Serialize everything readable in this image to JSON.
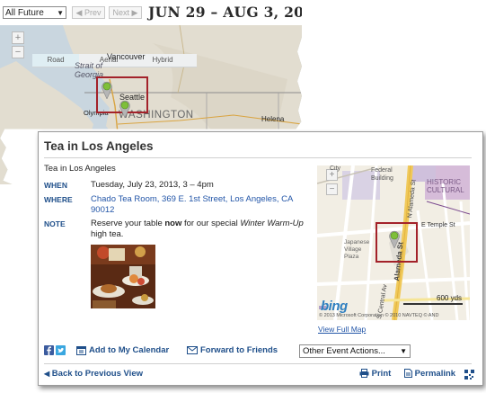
{
  "calendar": {
    "view_filter": "All Future",
    "prev_label": "◀ Prev",
    "next_label": "Next ▶",
    "date_range": "JUN 29 – AUG 3, 2013"
  },
  "region_map": {
    "tabs": [
      "Road",
      "Aerial",
      "Hybrid"
    ],
    "active_tab": "Road",
    "labels": {
      "vancouver": "Vancouver",
      "strait": "Strait of Georgia",
      "seattle": "Seattle",
      "olympia": "Olympia",
      "washington": "WASHINGTON",
      "helena": "Helena"
    }
  },
  "event": {
    "title": "Tea in Los Angeles",
    "subtitle": "Tea in Los Angeles",
    "when_label": "WHEN",
    "when": "Tuesday, July 23, 2013, 3 – 4pm",
    "where_label": "WHERE",
    "where_line1": "Chado Tea Room, 369 E. 1st Street, Los Angeles, CA",
    "where_line2": "90012",
    "note_label": "NOTE",
    "note_pre": "Reserve your table ",
    "note_bold": "now",
    "note_mid": " for our special ",
    "note_italic": "Winter Warm-Up",
    "note_line2": "high tea."
  },
  "local_map": {
    "labels": {
      "city": "City",
      "federal": "Federal",
      "building": "Building",
      "historic": "HISTORIC",
      "cultural": "CULTURAL",
      "e_temple": "E Temple St",
      "alameda": "Alameda St",
      "n_alameda": "N Alameda St",
      "central_av": "S Central Av",
      "japanese1": "Japanese",
      "japanese2": "Village",
      "japanese3": "Plaza",
      "scale": "600 yds",
      "copyright": "© 2013 Microsoft Corporation  © 2010 NAVTEQ  © AND",
      "logo": "bing"
    },
    "view_full_map": "View Full Map"
  },
  "actions": {
    "add_calendar": "Add to My Calendar",
    "forward": "Forward to Friends",
    "other": "Other Event Actions...",
    "back": "Back to Previous View",
    "print": "Print",
    "permalink": "Permalink"
  },
  "colors": {
    "link_blue": "#2356a8",
    "label_blue": "#1f4f8a",
    "highlight_red": "#a3222a",
    "pin_green": "#7fbf3a"
  }
}
